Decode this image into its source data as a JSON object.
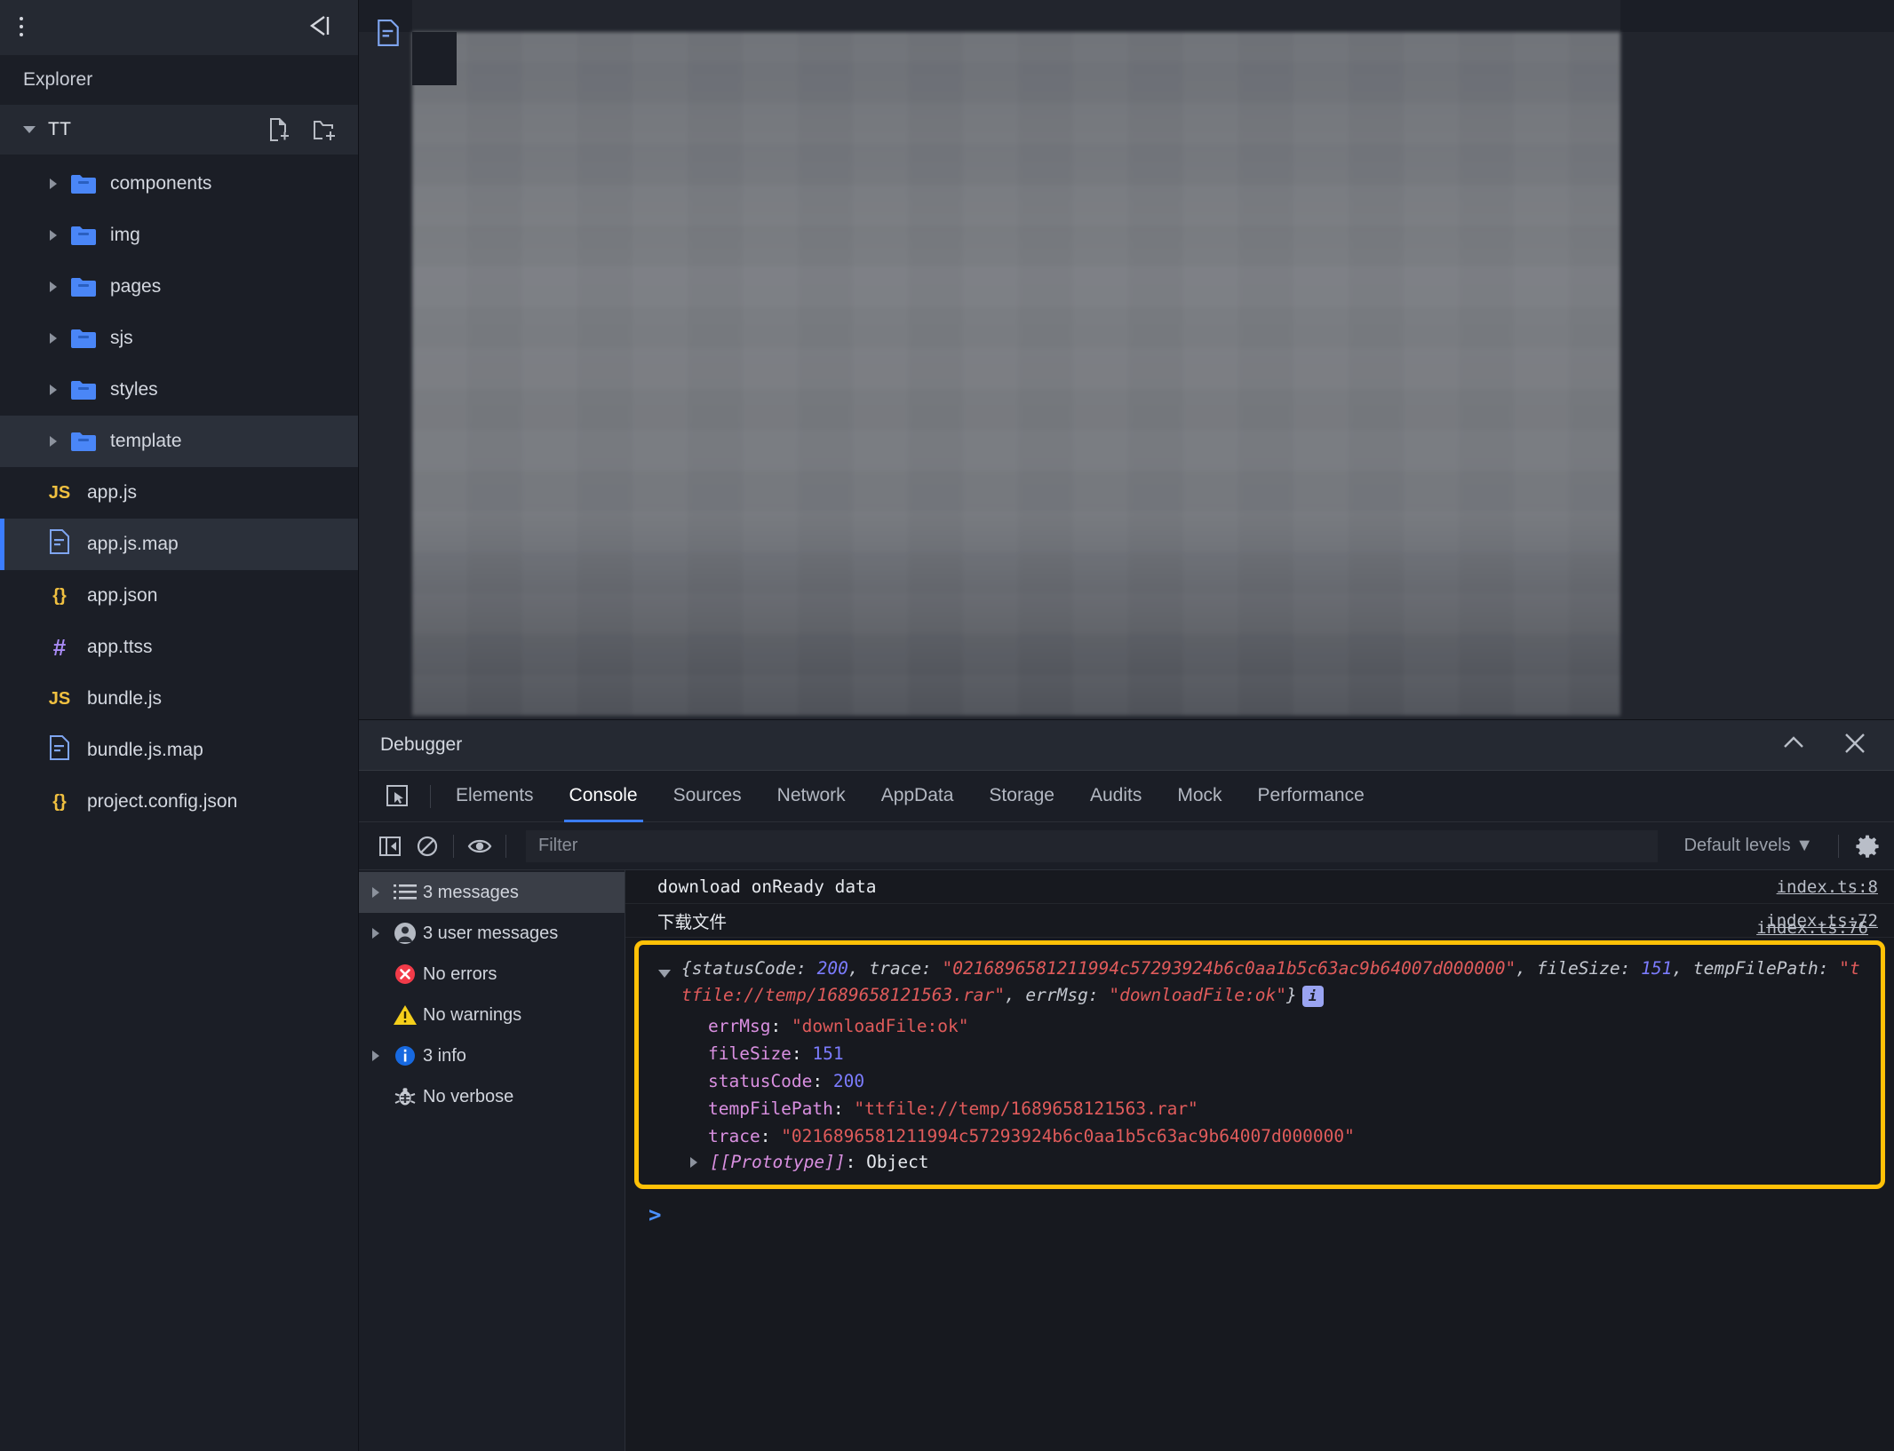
{
  "sidebar": {
    "hamburger_icon": "list-menu-icon",
    "collapse_icon": "collapse-sidebar-icon",
    "title": "Explorer",
    "root": {
      "label": "TT",
      "new_file_icon": "new-file-icon",
      "new_folder_icon": "new-folder-icon"
    },
    "folders": [
      {
        "label": "components",
        "icon": "folder-icon"
      },
      {
        "label": "img",
        "icon": "folder-icon"
      },
      {
        "label": "pages",
        "icon": "folder-icon"
      },
      {
        "label": "sjs",
        "icon": "folder-icon"
      },
      {
        "label": "styles",
        "icon": "folder-icon"
      },
      {
        "label": "template",
        "icon": "folder-icon",
        "selected": true
      }
    ],
    "files": [
      {
        "label": "app.js",
        "icon": "js-file-icon",
        "kind": "js"
      },
      {
        "label": "app.js.map",
        "icon": "map-file-icon",
        "kind": "map",
        "selected": true
      },
      {
        "label": "app.json",
        "icon": "json-file-icon",
        "kind": "json"
      },
      {
        "label": "app.ttss",
        "icon": "style-file-icon",
        "kind": "ttss"
      },
      {
        "label": "bundle.js",
        "icon": "js-file-icon",
        "kind": "js"
      },
      {
        "label": "bundle.js.map",
        "icon": "map-file-icon",
        "kind": "map"
      },
      {
        "label": "project.config.json",
        "icon": "json-file-icon",
        "kind": "json"
      }
    ]
  },
  "editor": {
    "tab_icon": "map-file-icon",
    "minimap_name": "code-minimap"
  },
  "debugger": {
    "title": "Debugger",
    "minimize_icon": "chevron-up-icon",
    "close_icon": "close-icon",
    "inspect_icon": "inspect-element-icon",
    "tabs": [
      {
        "label": "Elements",
        "active": false
      },
      {
        "label": "Console",
        "active": true
      },
      {
        "label": "Sources",
        "active": false
      },
      {
        "label": "Network",
        "active": false
      },
      {
        "label": "AppData",
        "active": false
      },
      {
        "label": "Storage",
        "active": false
      },
      {
        "label": "Audits",
        "active": false
      },
      {
        "label": "Mock",
        "active": false
      },
      {
        "label": "Performance",
        "active": false
      }
    ],
    "toolbar": {
      "sidebar_toggle_icon": "console-sidebar-icon",
      "clear_icon": "clear-console-icon",
      "eye_icon": "live-expression-icon",
      "filter_placeholder": "Filter",
      "filter_value": "",
      "levels_label": "Default levels",
      "levels_caret_icon": "chevron-down-icon",
      "settings_icon": "gear-icon"
    },
    "message_sidebar": [
      {
        "label": "3 messages",
        "icon": "list-icon",
        "expandable": true,
        "selected": true
      },
      {
        "label": "3 user messages",
        "icon": "user-icon",
        "expandable": true,
        "selected": false
      },
      {
        "label": "No errors",
        "icon": "error-icon",
        "expandable": false,
        "selected": false
      },
      {
        "label": "No warnings",
        "icon": "warning-icon",
        "expandable": false,
        "selected": false
      },
      {
        "label": "3 info",
        "icon": "info-icon",
        "expandable": true,
        "selected": false
      },
      {
        "label": "No verbose",
        "icon": "bug-icon",
        "expandable": false,
        "selected": false
      }
    ],
    "console": {
      "lines": [
        {
          "text": "download onReady data",
          "source": "index.ts:8"
        },
        {
          "text": "下载文件",
          "source": "index.ts:72"
        }
      ],
      "object_log": {
        "source": "index.ts:76",
        "highlight_color": "#ffc107",
        "summary_prefix": "{",
        "summary_parts": [
          {
            "t": "statusCode: ",
            "c": "plain"
          },
          {
            "t": "200",
            "c": "num"
          },
          {
            "t": ", trace: ",
            "c": "plain"
          },
          {
            "t": "\"0216896581211994c57293924b6c0aa1b5c63ac9b64007d000000\"",
            "c": "str"
          },
          {
            "t": ", fileSize: ",
            "c": "plain"
          },
          {
            "t": "151",
            "c": "num"
          },
          {
            "t": ", tempFilePath: ",
            "c": "plain"
          },
          {
            "t": "\"ttfile://temp/1689658121563.rar\"",
            "c": "str"
          },
          {
            "t": ", errMsg: ",
            "c": "plain"
          },
          {
            "t": "\"downloadFile:ok\"",
            "c": "str"
          },
          {
            "t": "}",
            "c": "plain"
          }
        ],
        "info_badge": "i",
        "properties": [
          {
            "key": "errMsg",
            "value": "\"downloadFile:ok\"",
            "type": "string"
          },
          {
            "key": "fileSize",
            "value": "151",
            "type": "number"
          },
          {
            "key": "statusCode",
            "value": "200",
            "type": "number"
          },
          {
            "key": "tempFilePath",
            "value": "\"ttfile://temp/1689658121563.rar\"",
            "type": "string"
          },
          {
            "key": "trace",
            "value": "\"0216896581211994c57293924b6c0aa1b5c63ac9b64007d000000\"",
            "type": "string"
          }
        ],
        "prototype_key": "[[Prototype]]",
        "prototype_value": "Object"
      },
      "prompt_symbol": ">"
    }
  }
}
